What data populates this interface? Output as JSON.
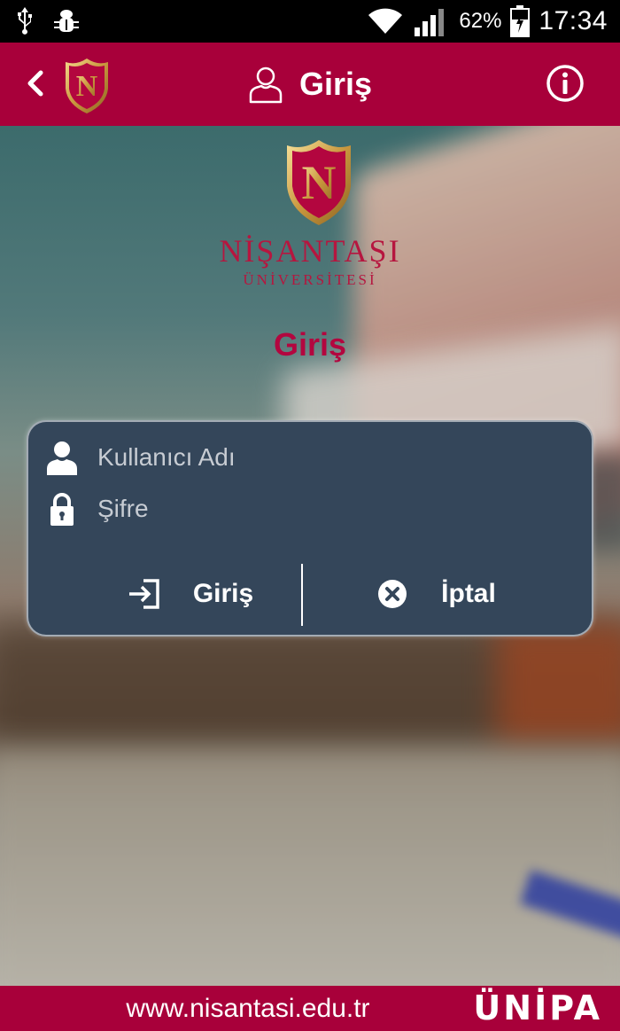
{
  "status_bar": {
    "battery_percent": "62%",
    "time": "17:34",
    "icons": [
      "usb-icon",
      "bug-icon",
      "wifi-icon",
      "signal-icon",
      "battery-charging-icon"
    ]
  },
  "app_bar": {
    "title": "Giriş",
    "back_icon": "chevron-left-icon",
    "info_icon": "info-icon"
  },
  "university": {
    "name": "NİŞANTAŞI",
    "subtitle": "ÜNİVERSİTESİ",
    "logo_letter": "N"
  },
  "page_heading": "Giriş",
  "login_form": {
    "username_placeholder": "Kullanıcı Adı",
    "password_placeholder": "Şifre",
    "login_label": "Giriş",
    "cancel_label": "İptal"
  },
  "footer": {
    "url": "www.nisantasi.edu.tr",
    "brand": "ÜNİPA"
  },
  "colors": {
    "brand": "#a8003a",
    "card": "#34465a",
    "heading": "#b3063f"
  }
}
